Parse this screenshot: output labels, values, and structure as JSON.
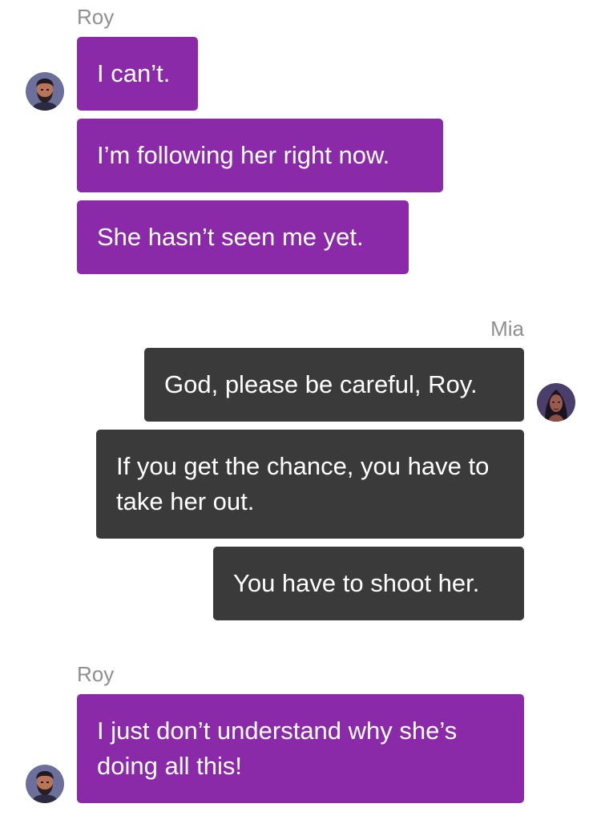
{
  "groups": [
    {
      "sender": "Roy",
      "messages": [
        "I can’t.",
        "I’m following her right now.",
        "She hasn’t seen me yet."
      ]
    },
    {
      "sender": "Mia",
      "messages": [
        "God, please be careful, Roy.",
        "If you get the chance, you have to take her out.",
        "You have to shoot her."
      ]
    },
    {
      "sender": "Roy",
      "messages": [
        "I just don’t understand why she’s doing all this!"
      ]
    }
  ],
  "avatars": {
    "roy": "roy-avatar-icon",
    "mia": "mia-avatar-icon"
  },
  "colors": {
    "roy_bubble": "#8a2aa8",
    "mia_bubble": "#3a3a3a",
    "sender_label": "#8e8e93",
    "background": "#ffffff"
  }
}
